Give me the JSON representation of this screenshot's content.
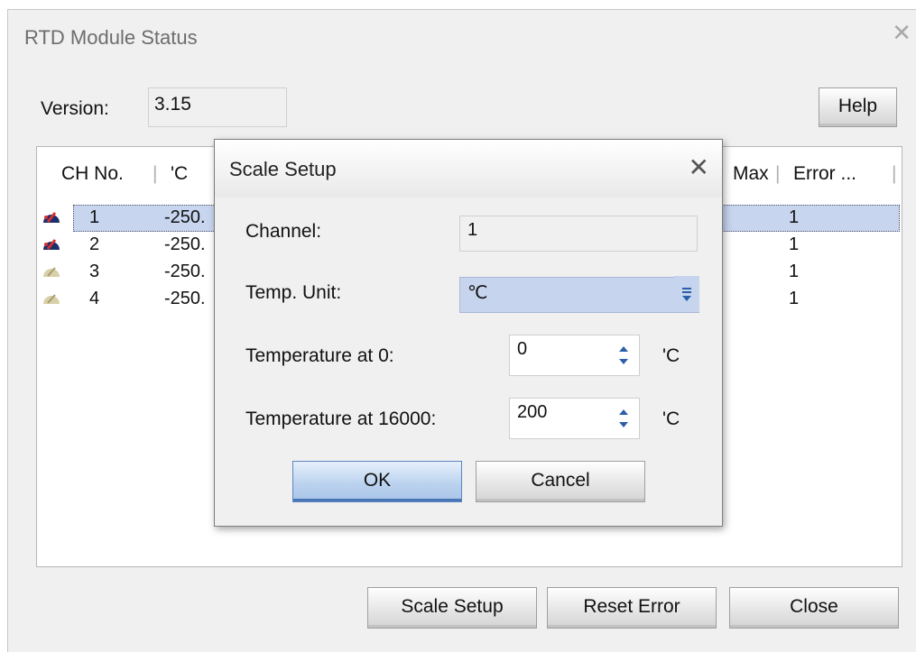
{
  "window": {
    "title": "RTD Module Status",
    "close_glyph": "✕",
    "version_label": "Version:",
    "version_value": "3.15",
    "help_label": "Help"
  },
  "table": {
    "headers": [
      "CH No.",
      "'C",
      "Max",
      "Error ..."
    ],
    "rows": [
      {
        "ch": "1",
        "value": "-250.",
        "error": "1",
        "icon": "active-gauge-icon",
        "selected": true
      },
      {
        "ch": "2",
        "value": "-250.",
        "error": "1",
        "icon": "active-gauge-icon",
        "selected": false
      },
      {
        "ch": "3",
        "value": "-250.",
        "error": "1",
        "icon": "inactive-gauge-icon",
        "selected": false
      },
      {
        "ch": "4",
        "value": "-250.",
        "error": "1",
        "icon": "inactive-gauge-icon",
        "selected": false
      }
    ]
  },
  "buttons": {
    "scale_setup": "Scale Setup",
    "reset_error": "Reset Error",
    "close": "Close"
  },
  "dialog": {
    "title": "Scale Setup",
    "close_glyph": "✕",
    "channel_label": "Channel:",
    "channel_value": "1",
    "temp_unit_label": "Temp. Unit:",
    "temp_unit_value": "℃",
    "temp_at_0_label": "Temperature at 0:",
    "temp_at_0_value": "0",
    "temp_at_0_unit": "'C",
    "temp_at_16000_label": "Temperature at 16000:",
    "temp_at_16000_value": "200",
    "temp_at_16000_unit": "'C",
    "ok_label": "OK",
    "cancel_label": "Cancel"
  },
  "colors": {
    "selection": "#c7d5ef",
    "ok_button": "#bcd3ef",
    "active_icon": "#1a2f6b",
    "active_icon_accent": "#d83030",
    "inactive_icon": "#d8d0a8"
  }
}
